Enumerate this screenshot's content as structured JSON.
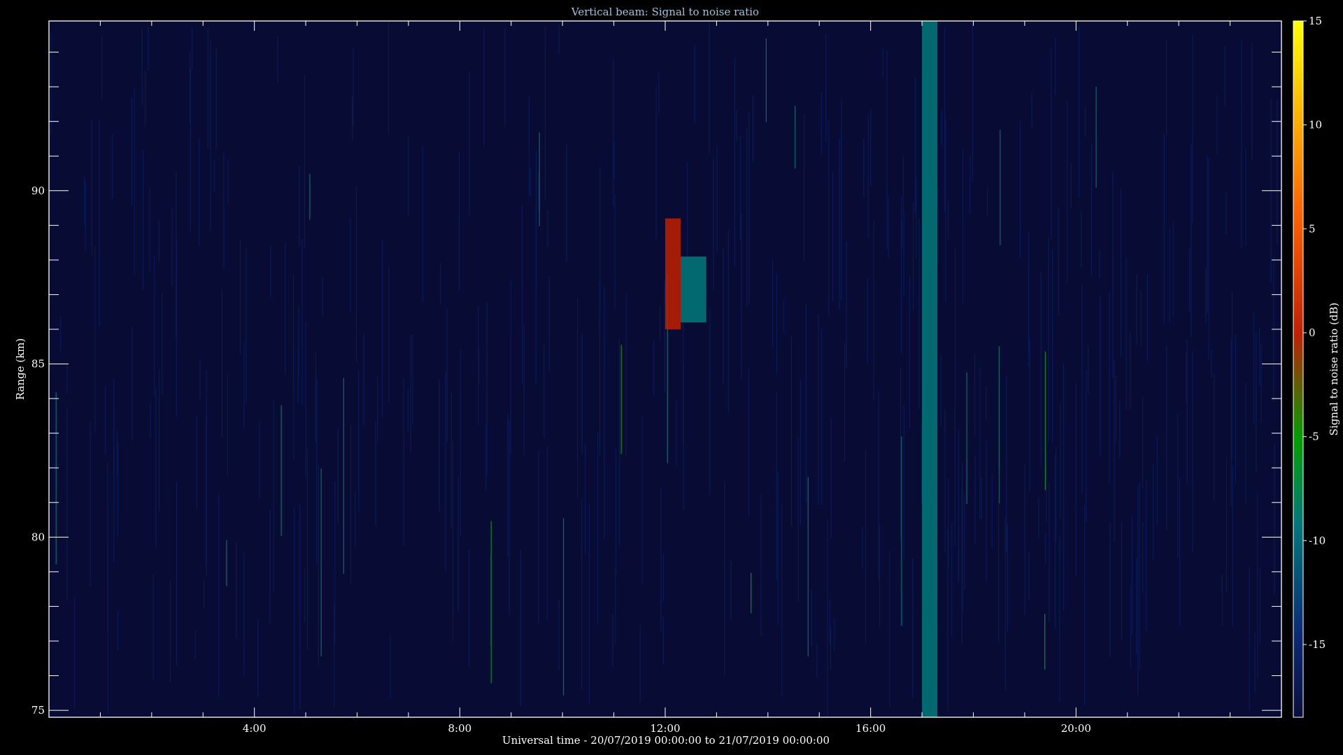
{
  "chart_data": {
    "type": "heatmap",
    "title": "Vertical beam: Signal to noise ratio",
    "xlabel": "Universal time - 20/07/2019 00:00:00 to 21/07/2019 00:00:00",
    "ylabel": "Range (km)",
    "colorbar_label": "Signal to noise ratio (dB)",
    "x_range_hours": [
      0,
      24
    ],
    "y_range_km": [
      74.8,
      94.9
    ],
    "x_ticks": [
      {
        "hour": 4,
        "label": "4:00"
      },
      {
        "hour": 8,
        "label": "8:00"
      },
      {
        "hour": 12,
        "label": "12:00"
      },
      {
        "hour": 16,
        "label": "16:00"
      },
      {
        "hour": 20,
        "label": "20:00"
      }
    ],
    "y_ticks": [
      {
        "km": 75,
        "label": "75"
      },
      {
        "km": 80,
        "label": "80"
      },
      {
        "km": 85,
        "label": "85"
      },
      {
        "km": 90,
        "label": "90"
      }
    ],
    "colorbar_range_db": [
      -18.5,
      15
    ],
    "colorbar_ticks": [
      {
        "db": 15,
        "label": "15"
      },
      {
        "db": 10,
        "label": "10"
      },
      {
        "db": 5,
        "label": "5"
      },
      {
        "db": 0,
        "label": "0"
      },
      {
        "db": -5,
        "label": "-5"
      },
      {
        "db": -10,
        "label": "-10"
      },
      {
        "db": -15,
        "label": "-15"
      }
    ],
    "background_db": -18,
    "colormap": [
      "#0a0f3c",
      "#0b2a78",
      "#007a7a",
      "#00a000",
      "#c02000",
      "#ff6000",
      "#ffff00"
    ],
    "features": [
      {
        "name": "echo",
        "hour_start": 12.0,
        "hour_end": 12.3,
        "km_start": 86.0,
        "km_end": 89.2,
        "db": 3
      },
      {
        "name": "echo-tail",
        "hour_start": 12.3,
        "hour_end": 12.8,
        "km_start": 86.2,
        "km_end": 88.1,
        "db": -6
      },
      {
        "name": "interference-band",
        "hour_start": 17.0,
        "hour_end": 17.3,
        "km_start": 74.8,
        "km_end": 94.9,
        "db": -8
      }
    ]
  }
}
